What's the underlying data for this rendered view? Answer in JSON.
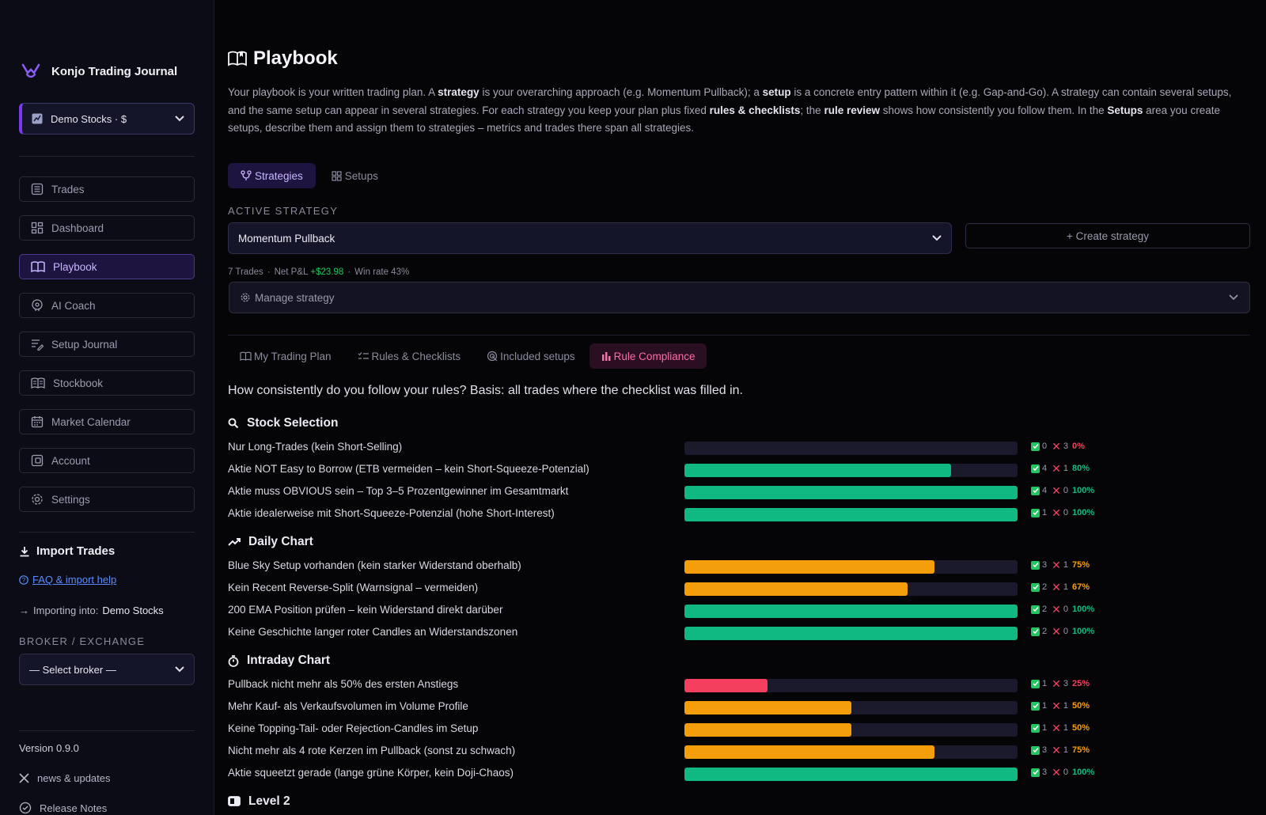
{
  "sidebar": {
    "brand": "Konjo Trading Journal",
    "account": "Demo Stocks · $",
    "nav": [
      {
        "label": "Trades",
        "icon": "list-icon"
      },
      {
        "label": "Dashboard",
        "icon": "grid-icon"
      },
      {
        "label": "Playbook",
        "icon": "book-icon",
        "active": true
      },
      {
        "label": "AI Coach",
        "icon": "brain-icon"
      },
      {
        "label": "Setup Journal",
        "icon": "notes-icon"
      },
      {
        "label": "Stockbook",
        "icon": "open-book-icon"
      },
      {
        "label": "Market Calendar",
        "icon": "calendar-icon"
      },
      {
        "label": "Account",
        "icon": "wallet-icon"
      },
      {
        "label": "Settings",
        "icon": "gear-icon"
      }
    ],
    "import_title": "Import Trades",
    "faq": "FAQ & import help",
    "importing_prefix": "Importing into:",
    "importing_target": "Demo Stocks",
    "broker_label": "BROKER / EXCHANGE",
    "broker_placeholder": "— Select broker —",
    "version": "Version 0.9.0",
    "news": "news & updates",
    "release_notes": "Release Notes"
  },
  "main": {
    "title": "Playbook",
    "intro": {
      "p1": "Your playbook is your written trading plan. A ",
      "b1": "strategy",
      "p2": " is your overarching approach (e.g. Momentum Pullback); a ",
      "b2": "setup",
      "p3": " is a concrete entry pattern within it (e.g. Gap-and-Go). A strategy can contain several setups, and the same setup can appear in several strategies. For each strategy you keep your plan plus fixed ",
      "b3": "rules & checklists",
      "p4": "; the ",
      "b4": "rule review",
      "p5": " shows how consistently you follow them. In the ",
      "b5": "Setups",
      "p6": " area you create setups, describe them and assign them to strategies – metrics and trades there span all strategies."
    },
    "top_tabs": [
      "Strategies",
      "Setups"
    ],
    "active_strategy_label": "ACTIVE STRATEGY",
    "active_strategy": "Momentum Pullback",
    "create_strategy": "+ Create strategy",
    "stats": {
      "trades": "7 Trades",
      "sep": "·",
      "pnl_label": "Net P&L",
      "pnl_value": "+$23.98",
      "winrate": "Win rate 43%"
    },
    "manage_strategy": "Manage strategy",
    "sub_tabs": [
      "My Trading Plan",
      "Rules & Checklists",
      "Included setups",
      "Rule Compliance"
    ],
    "question": "How consistently do you follow your rules? Basis: all trades where the checklist was filled in."
  },
  "colors": {
    "good": "#10b981",
    "mid": "#f59e0b",
    "bad": "#f43f5e",
    "accent": "#7c3aed"
  },
  "compliance": [
    {
      "title": "Stock Selection",
      "icon": "search-icon",
      "rules": [
        {
          "label": "Nur Long-Trades (kein Short-Selling)",
          "ok": 0,
          "fail": 3,
          "pct": 0
        },
        {
          "label": "Aktie NOT Easy to Borrow (ETB vermeiden – kein Short-Squeeze-Potenzial)",
          "ok": 4,
          "fail": 1,
          "pct": 80
        },
        {
          "label": "Aktie muss OBVIOUS sein – Top 3–5 Prozentgewinner im Gesamtmarkt",
          "ok": 4,
          "fail": 0,
          "pct": 100
        },
        {
          "label": "Aktie idealerweise mit Short-Squeeze-Potenzial (hohe Short-Interest)",
          "ok": 1,
          "fail": 0,
          "pct": 100
        }
      ]
    },
    {
      "title": "Daily Chart",
      "icon": "trend-icon",
      "rules": [
        {
          "label": "Blue Sky Setup vorhanden (kein starker Widerstand oberhalb)",
          "ok": 3,
          "fail": 1,
          "pct": 75
        },
        {
          "label": "Kein Recent Reverse-Split (Warnsignal – vermeiden)",
          "ok": 2,
          "fail": 1,
          "pct": 67
        },
        {
          "label": "200 EMA Position prüfen – kein Widerstand direkt darüber",
          "ok": 2,
          "fail": 0,
          "pct": 100
        },
        {
          "label": "Keine Geschichte langer roter Candles an Widerstandszonen",
          "ok": 2,
          "fail": 0,
          "pct": 100
        }
      ]
    },
    {
      "title": "Intraday Chart",
      "icon": "stopwatch-icon",
      "rules": [
        {
          "label": "Pullback nicht mehr als 50% des ersten Anstiegs",
          "ok": 1,
          "fail": 3,
          "pct": 25
        },
        {
          "label": "Mehr Kauf- als Verkaufsvolumen im Volume Profile",
          "ok": 1,
          "fail": 1,
          "pct": 50
        },
        {
          "label": "Keine Topping-Tail- oder Rejection-Candles im Setup",
          "ok": 1,
          "fail": 1,
          "pct": 50
        },
        {
          "label": "Nicht mehr als 4 rote Kerzen im Pullback (sonst zu schwach)",
          "ok": 3,
          "fail": 1,
          "pct": 75
        },
        {
          "label": "Aktie squeetzt gerade (lange grüne Körper, kein Doji-Chaos)",
          "ok": 3,
          "fail": 0,
          "pct": 100
        }
      ]
    },
    {
      "title": "Level 2",
      "icon": "level-icon",
      "rules": []
    }
  ]
}
